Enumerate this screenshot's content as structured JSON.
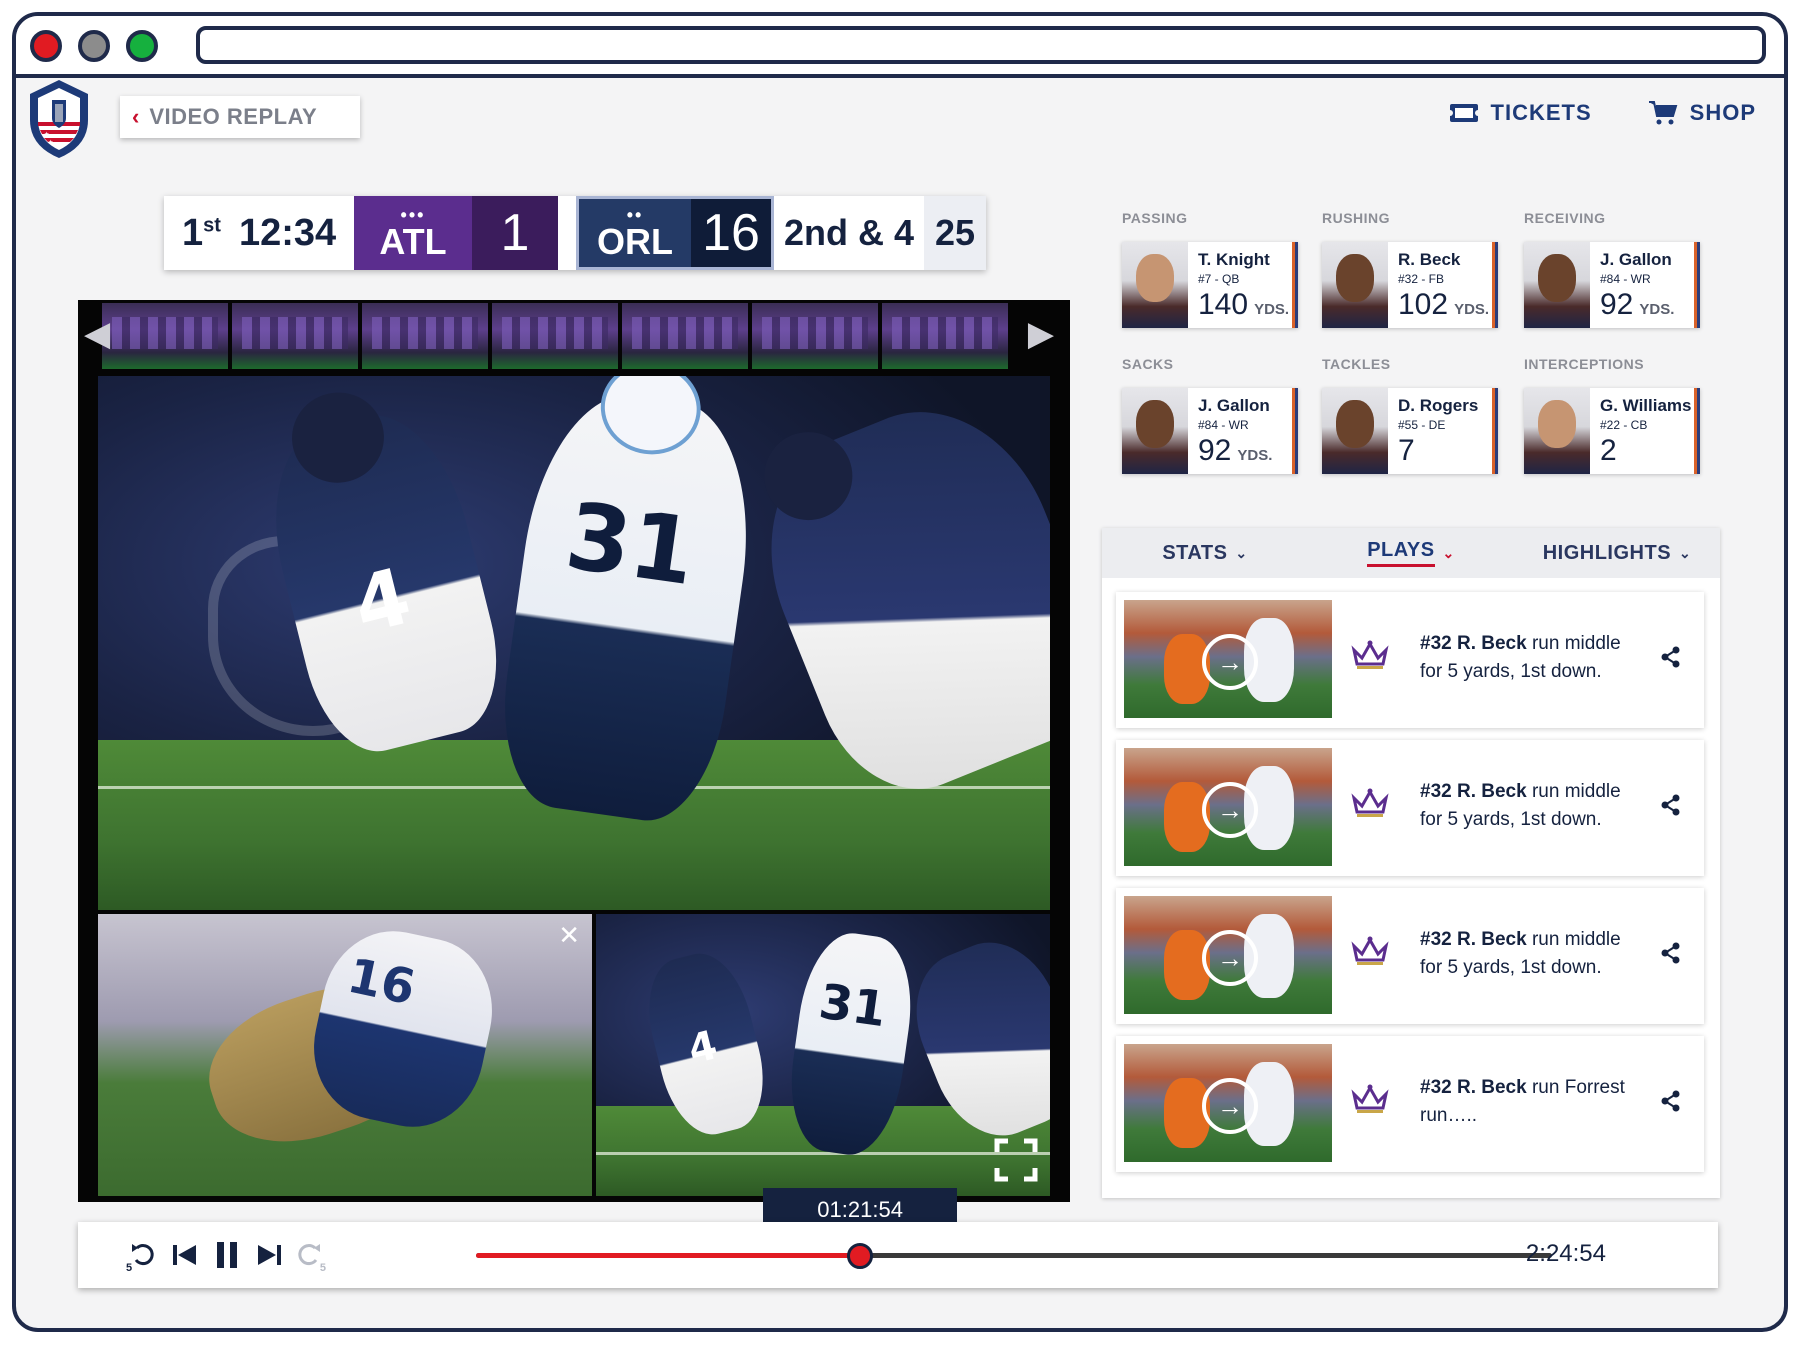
{
  "nav": {
    "back_label": "VIDEO REPLAY",
    "tickets_label": "TICKETS",
    "shop_label": "SHOP"
  },
  "scoreboard": {
    "quarter": "1",
    "quarter_suffix": "st",
    "clock": "12:34",
    "home": {
      "abbr": "ATL",
      "score": "1",
      "timeouts": "•••"
    },
    "away": {
      "abbr": "ORL",
      "score": "16",
      "timeouts": "••"
    },
    "down_distance": "2nd & 4",
    "yard_line": "25"
  },
  "player": {
    "current_time": "01:21:54",
    "total_time": "2:24:54",
    "progress": 0.357,
    "skip_back_seconds": "5",
    "skip_forward_seconds": "5"
  },
  "stats": [
    {
      "category": "PASSING",
      "name": "T. Knight",
      "meta": "#7 - QB",
      "value": "140",
      "unit": "YDS.",
      "skin": "light"
    },
    {
      "category": "RUSHING",
      "name": "R. Beck",
      "meta": "#32 - FB",
      "value": "102",
      "unit": "YDS.",
      "skin": "dark"
    },
    {
      "category": "RECEIVING",
      "name": "J. Gallon",
      "meta": "#84 - WR",
      "value": "92",
      "unit": "YDS.",
      "skin": "dark"
    },
    {
      "category": "SACKS",
      "name": "J. Gallon",
      "meta": "#84 - WR",
      "value": "92",
      "unit": "YDS.",
      "skin": "dark"
    },
    {
      "category": "TACKLES",
      "name": "D. Rogers",
      "meta": "#55 - DE",
      "value": "7",
      "unit": "",
      "skin": "dark"
    },
    {
      "category": "INTERCEPTIONS",
      "name": "G. Williams",
      "meta": "#22 - CB",
      "value": "2",
      "unit": "",
      "skin": "light"
    }
  ],
  "tabs": [
    {
      "label": "STATS",
      "active": false
    },
    {
      "label": "PLAYS",
      "active": true
    },
    {
      "label": "HIGHLIGHTS",
      "active": false
    }
  ],
  "plays": [
    {
      "player": "#32 R. Beck",
      "text": "run middle for 5 yards, 1st down."
    },
    {
      "player": "#32 R. Beck",
      "text": "run middle for 5 yards, 1st down."
    },
    {
      "player": "#32 R. Beck",
      "text": "run middle for 5 yards, 1st down."
    },
    {
      "player": "#32 R. Beck",
      "text": "run Forrest run….."
    }
  ],
  "colors": {
    "navy": "#15223f",
    "brand_blue": "#1d3a78",
    "accent_red": "#e11b22",
    "atl_purple": "#5b2d8e",
    "orl_navy": "#0f1c38"
  },
  "video": {
    "main_jersey_a": "4",
    "main_jersey_b": "31",
    "sub_a_jersey": "16",
    "sub_b_jersey_a": "4",
    "sub_b_jersey_b": "31"
  }
}
